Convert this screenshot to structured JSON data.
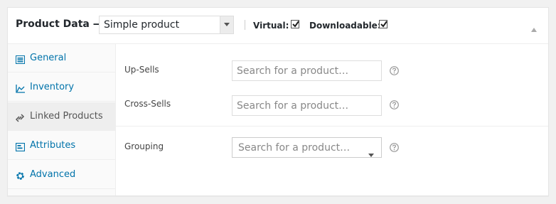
{
  "header": {
    "title": "Product Data —",
    "product_type": "Simple product",
    "virtual_label": "Virtual:",
    "virtual_checked": true,
    "downloadable_label": "Downloadable:",
    "downloadable_checked": true
  },
  "tabs": [
    {
      "label": "General",
      "icon": "general-icon",
      "active": false
    },
    {
      "label": "Inventory",
      "icon": "inventory-icon",
      "active": false
    },
    {
      "label": "Linked Products",
      "icon": "link-icon",
      "active": true
    },
    {
      "label": "Attributes",
      "icon": "attributes-icon",
      "active": false
    },
    {
      "label": "Advanced",
      "icon": "gear-icon",
      "active": false
    }
  ],
  "fields": [
    {
      "label": "Up-Sells",
      "placeholder": "Search for a product…"
    },
    {
      "label": "Cross-Sells",
      "placeholder": "Search for a product…"
    },
    {
      "label": "Grouping",
      "placeholder": "Search for a product…"
    }
  ],
  "colors": {
    "link": "#0073aa",
    "active_tab_bg": "#eeeeee"
  }
}
